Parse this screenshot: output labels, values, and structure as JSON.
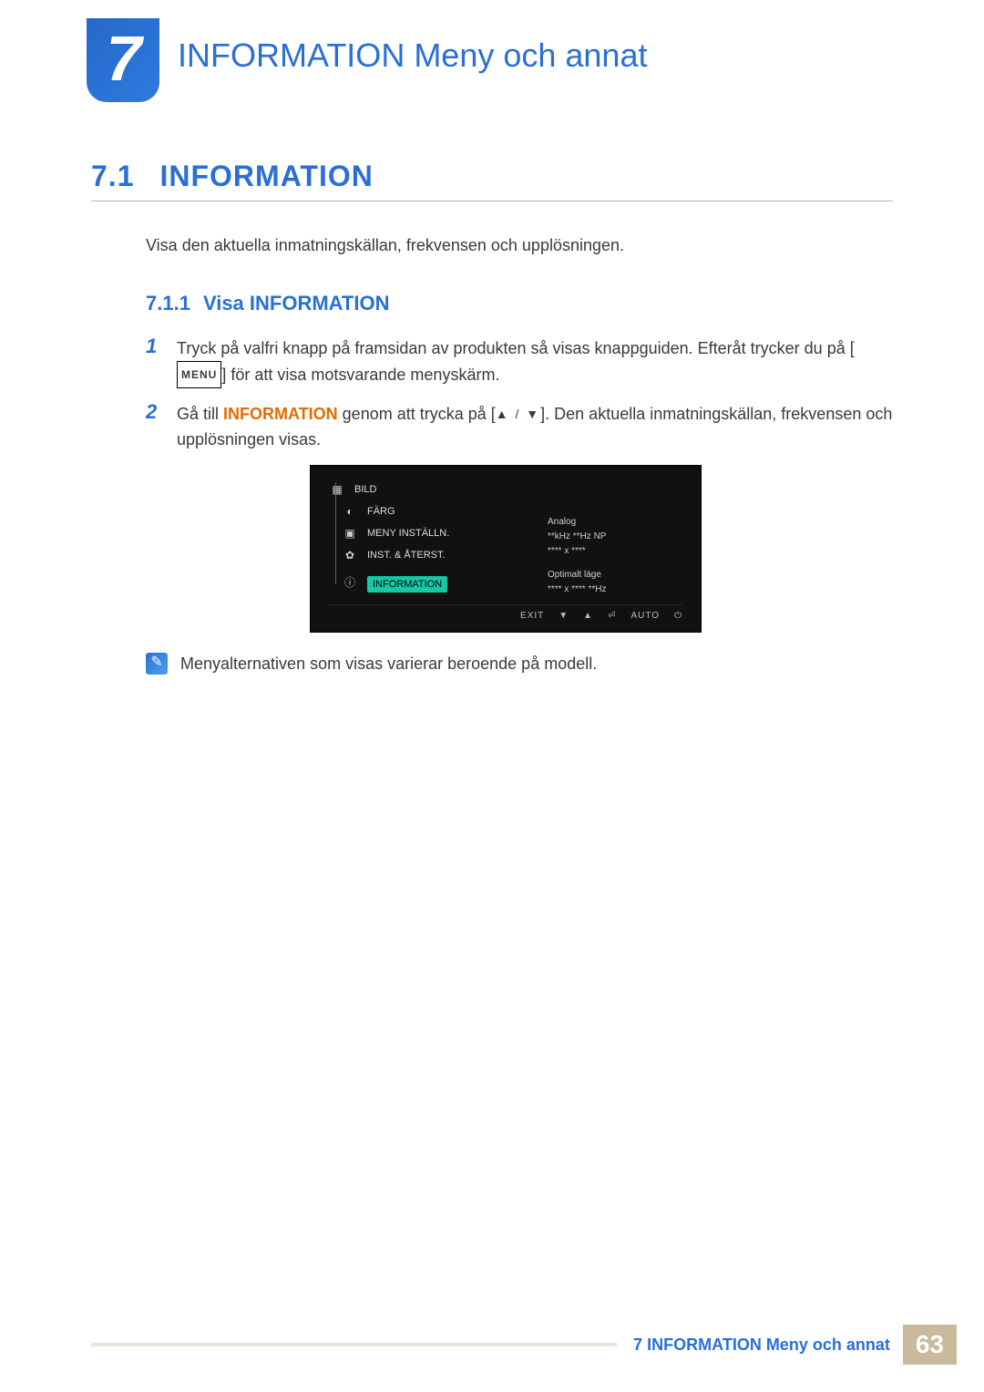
{
  "chapter": {
    "number": "7",
    "title": "INFORMATION Meny och annat"
  },
  "h1": {
    "number": "7.1",
    "text": "INFORMATION"
  },
  "intro": "Visa den aktuella inmatningskällan, frekvensen och upplösningen.",
  "h2": {
    "number": "7.1.1",
    "text": "Visa INFORMATION"
  },
  "steps": {
    "s1_num": "1",
    "s1_a": "Tryck på valfri knapp på framsidan av produkten så visas knappguiden. Efteråt trycker du på [",
    "s1_key": "MENU",
    "s1_b": "] för att visa motsvarande menyskärm.",
    "s2_num": "2",
    "s2_a": "Gå till ",
    "s2_kw": "INFORMATION",
    "s2_b": " genom att trycka på [",
    "s2_arrows": "▲ / ▼",
    "s2_c": "]. Den aktuella inmatningskällan, frekvensen och upplösningen visas."
  },
  "osd": {
    "items": [
      "BILD",
      "FÄRG",
      "MENY INSTÄLLN.",
      "INST. & ÅTERST."
    ],
    "selected": "INFORMATION",
    "right": {
      "l1": "Analog",
      "l2": "**kHz  **Hz  NP",
      "l3": "**** x ****",
      "l4": "Optimalt läge",
      "l5": "**** x ****   **Hz"
    },
    "foot": {
      "exit": "EXIT",
      "down": "▼",
      "up": "▲",
      "enter": "⏎",
      "auto": "AUTO",
      "power": "⏻"
    }
  },
  "note": "Menyalternativen som visas varierar beroende på modell.",
  "footer": {
    "label": "7 INFORMATION Meny och annat",
    "page": "63"
  }
}
